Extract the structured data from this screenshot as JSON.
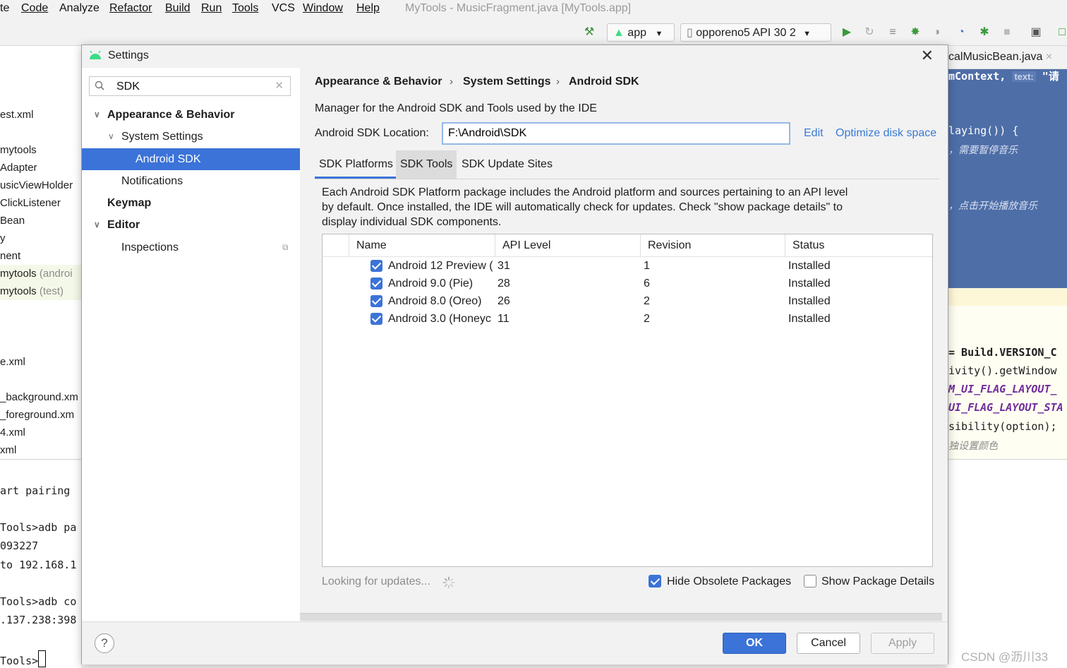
{
  "ide": {
    "menu": [
      "te",
      "Code",
      "Analyze",
      "Refactor",
      "Build",
      "Run",
      "Tools",
      "VCS",
      "Window",
      "Help"
    ],
    "window_title": "MyTools - MusicFragment.java [MyTools.app]",
    "run_config": "app",
    "device": "opporeno5 API 30 2",
    "editor_tab": "calMusicBean.java",
    "left_files": [
      "est.xml",
      "mytools",
      "Adapter",
      "usicViewHolder",
      "ClickListener",
      "Bean",
      "y",
      "nent",
      "mytools",
      "(androi",
      "mytools",
      "(test)",
      "e.xml",
      "_background.xm",
      "_foreground.xm",
      "4.xml",
      "xml"
    ],
    "terminal_lines": [
      "art pairing",
      "Tools>adb pa",
      "093227",
      "to 192.168.1",
      "Tools>adb co",
      ".137.238:398",
      "Tools>"
    ],
    "code_lines": [
      "mContext,",
      "text:",
      "\"请",
      "laying()) {",
      "，需要暂停音乐",
      "，点击开始播放音乐",
      "= Build.VERSION_C",
      "ivity().getWindow",
      "M_UI_FLAG_LAYOUT_",
      "UI_FLAG_LAYOUT_STA",
      "sibility(option);",
      "独设置颜色"
    ],
    "watermark": "CSDN @沥川33"
  },
  "dialog": {
    "title": "Settings",
    "search_value": "SDK",
    "tree": {
      "appearance": "Appearance & Behavior",
      "system_settings": "System Settings",
      "android_sdk": "Android SDK",
      "notifications": "Notifications",
      "keymap": "Keymap",
      "editor": "Editor",
      "inspections": "Inspections"
    },
    "breadcrumb": [
      "Appearance & Behavior",
      "System Settings",
      "Android SDK"
    ],
    "breadcrumb_sep": "›",
    "description": "Manager for the Android SDK and Tools used by the IDE",
    "location_label": "Android SDK Location:",
    "location_value": "F:\\Android\\SDK",
    "edit_link": "Edit",
    "optimize_link": "Optimize disk space",
    "tabs": [
      "SDK Platforms",
      "SDK Tools",
      "SDK Update Sites"
    ],
    "info": "Each Android SDK Platform package includes the Android platform and sources pertaining to an API level by default. Once installed, the IDE will automatically check for updates. Check \"show package details\" to display individual SDK components.",
    "table": {
      "headers": [
        "Name",
        "API Level",
        "Revision",
        "Status"
      ],
      "rows": [
        {
          "name": "Android 12 Preview (",
          "api": "31",
          "revision": "1",
          "status": "Installed",
          "checked": true
        },
        {
          "name": "Android 9.0 (Pie)",
          "api": "28",
          "revision": "6",
          "status": "Installed",
          "checked": true
        },
        {
          "name": "Android 8.0 (Oreo)",
          "api": "26",
          "revision": "2",
          "status": "Installed",
          "checked": true
        },
        {
          "name": "Android 3.0 (Honeyc",
          "api": "11",
          "revision": "2",
          "status": "Installed",
          "checked": true
        }
      ]
    },
    "status_text": "Looking for updates...",
    "hide_obsolete_label": "Hide Obsolete Packages",
    "hide_obsolete_checked": true,
    "show_details_label": "Show Package Details",
    "show_details_checked": false,
    "buttons": {
      "help": "?",
      "ok": "OK",
      "cancel": "Cancel",
      "apply": "Apply"
    },
    "colors": {
      "accent": "#3b73d8",
      "link": "#3a7bd5",
      "android_green": "#3ddc84"
    }
  }
}
